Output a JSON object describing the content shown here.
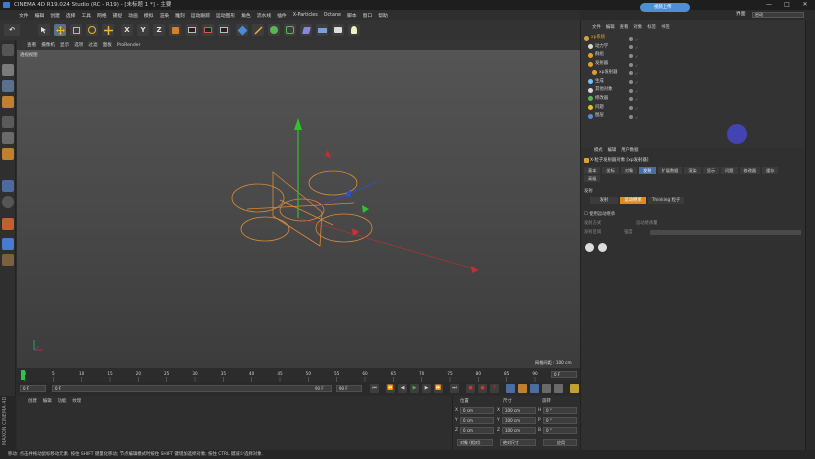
{
  "window": {
    "title": "CINEMA 4D R19.024 Studio (RC - R19) - [未标题 1 *] - 主要",
    "controls": [
      "—",
      "□",
      "✕"
    ]
  },
  "menubar": [
    "文件",
    "编辑",
    "创建",
    "选择",
    "工具",
    "网格",
    "捕捉",
    "动画",
    "模拟",
    "渲染",
    "雕刻",
    "运动跟踪",
    "运动图形",
    "角色",
    "流水线",
    "插件",
    "X-Particles",
    "Octane",
    "脚本",
    "窗口",
    "帮助"
  ],
  "layout": {
    "label": "界面",
    "value": "启动"
  },
  "cloud_pill": "视频上传",
  "toolbar": {
    "undo": "↶",
    "axis_x": "X",
    "axis_y": "Y",
    "axis_z": "Z"
  },
  "viewport": {
    "menu": [
      "查看",
      "摄像机",
      "显示",
      "选项",
      "过滤",
      "面板",
      "ProRender"
    ],
    "label": "透视视图",
    "grid_spacing": "网格间距 : 100 cm"
  },
  "timeline": {
    "ticks": [
      "0",
      "5",
      "10",
      "15",
      "20",
      "25",
      "30",
      "35",
      "40",
      "45",
      "50",
      "55",
      "60",
      "65",
      "70",
      "75",
      "80",
      "85",
      "90"
    ],
    "end_frame": "0 F"
  },
  "transport": {
    "start_field": "0 F",
    "current_field": "0 F",
    "range_end": "90 F",
    "end_field": "90 F"
  },
  "materials": {
    "menu": [
      "创建",
      "编辑",
      "功能",
      "纹理"
    ]
  },
  "brand_text": "MAXON CINEMA 4D",
  "coordinates": {
    "headers": {
      "position": "位置",
      "size": "尺寸",
      "rotation": "旋转"
    },
    "rows": [
      {
        "axis": "X",
        "pos": "0 cm",
        "size": "100 cm",
        "rot_axis": "H",
        "rot": "0 °"
      },
      {
        "axis": "Y",
        "pos": "0 cm",
        "size": "100 cm",
        "rot_axis": "P",
        "rot": "0 °"
      },
      {
        "axis": "Z",
        "pos": "0 cm",
        "size": "100 cm",
        "rot_axis": "B",
        "rot": "0 °"
      }
    ],
    "mode_object": "对象 (相对)",
    "mode_size": "绝对尺寸",
    "apply": "应用"
  },
  "status": "移动: 点击并拖动鼠标移动元素. 按住 SHIFT 键量化移动; 节点编辑模式时按住 SHIFT 键增加选择对象; 按住 CTRL 键减少选择对象.",
  "object_manager": {
    "tabs": [
      "文件",
      "编辑",
      "查看",
      "对象",
      "标签",
      "书签"
    ],
    "items": [
      {
        "name": "xp系统",
        "color": "#e0a030",
        "depth": 0
      },
      {
        "name": "动力学",
        "color": "#d8d8d8",
        "depth": 1
      },
      {
        "name": "群组",
        "color": "#e0a030",
        "depth": 1
      },
      {
        "name": "发射器",
        "color": "#e0a030",
        "depth": 1
      },
      {
        "name": "xp发射器",
        "color": "#e0a030",
        "depth": 2
      },
      {
        "name": "生成",
        "color": "#7ac0f0",
        "depth": 1
      },
      {
        "name": "其他对象",
        "color": "#d8d8d8",
        "depth": 1
      },
      {
        "name": "修改器",
        "color": "#5ab45a",
        "depth": 1
      },
      {
        "name": "问题",
        "color": "#e0c030",
        "depth": 1
      },
      {
        "name": "图层",
        "color": "#5a8ad8",
        "depth": 1
      }
    ]
  },
  "attributes": {
    "top_tabs": [
      "模式",
      "编辑",
      "用户数据"
    ],
    "title": "X-粒子发射器对象 [xp发射器]",
    "tabs_row1": [
      "基本",
      "坐标",
      "对象",
      "发射",
      "扩展数据",
      "渲染",
      "显示",
      "问题",
      "修改器",
      "缓存"
    ],
    "tabs_row2": [
      "高级"
    ],
    "active_tab": "发射",
    "section": "发射",
    "subtabs": [
      "发射",
      "运动继承",
      "Thinking 粒子"
    ],
    "active_subtab": "运动继承",
    "option_use": "使用运动继承",
    "option_a": "发射方式",
    "option_b": "运动继承量",
    "option_c": "发射区域",
    "option_d": "强度"
  }
}
